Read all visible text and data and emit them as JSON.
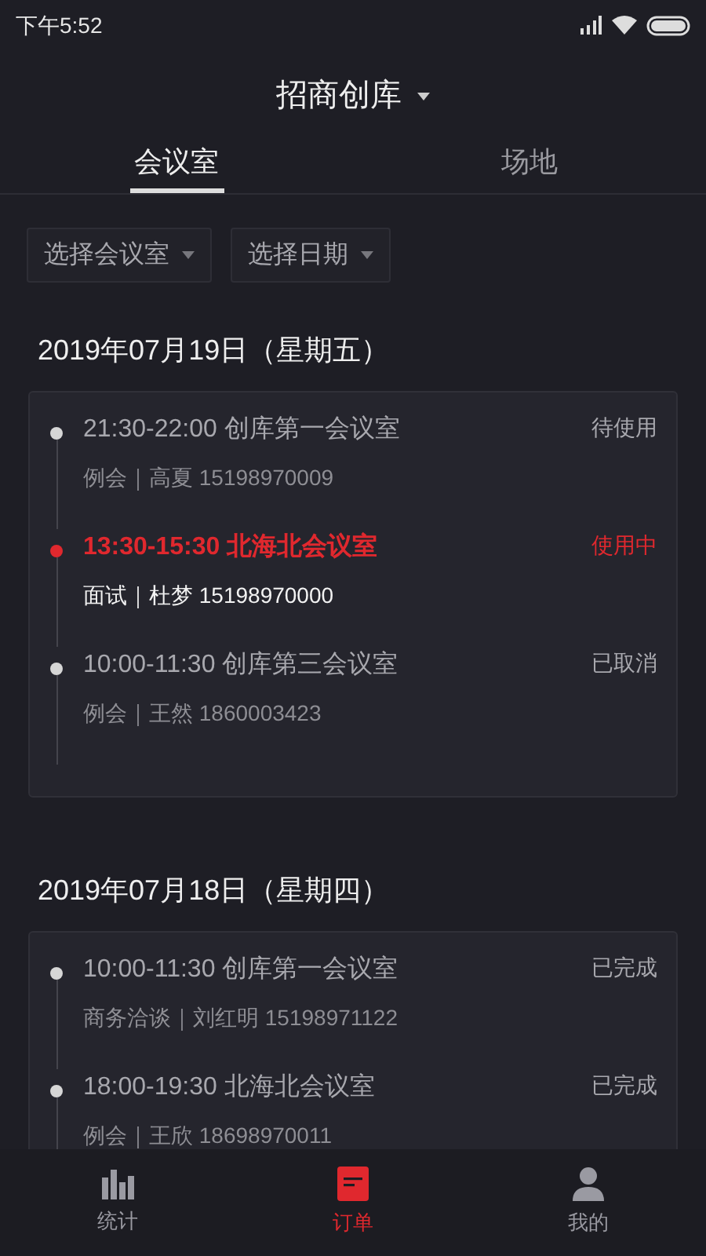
{
  "status_bar": {
    "time": "下午5:52"
  },
  "header": {
    "title": "招商创库"
  },
  "tabs": [
    {
      "label": "会议室",
      "selected": true
    },
    {
      "label": "场地",
      "selected": false
    }
  ],
  "filters": [
    {
      "label": "选择会议室"
    },
    {
      "label": "选择日期"
    }
  ],
  "days": [
    {
      "date": "2019年07月19日（星期五）",
      "bookings": [
        {
          "time": "21:30-22:00",
          "room": "创库第一会议室",
          "detail": "例会｜高夏 15198970009",
          "status": "待使用",
          "active": false
        },
        {
          "time": "13:30-15:30",
          "room": "北海北会议室",
          "detail": "面试｜杜梦 15198970000",
          "status": "使用中",
          "active": true
        },
        {
          "time": "10:00-11:30",
          "room": "创库第三会议室",
          "detail": "例会｜王然 1860003423",
          "status": "已取消",
          "active": false
        }
      ]
    },
    {
      "date": "2019年07月18日（星期四）",
      "bookings": [
        {
          "time": "10:00-11:30",
          "room": "创库第一会议室",
          "detail": "商务洽谈｜刘红明 15198971122",
          "status": "已完成",
          "active": false
        },
        {
          "time": "18:00-19:30",
          "room": "北海北会议室",
          "detail": "例会｜王欣 18698970011",
          "status": "已完成",
          "active": false
        }
      ]
    }
  ],
  "nav": [
    {
      "label": "统计",
      "kind": "stats",
      "selected": false
    },
    {
      "label": "订单",
      "kind": "orders",
      "selected": true
    },
    {
      "label": "我的",
      "kind": "profile",
      "selected": false
    }
  ]
}
